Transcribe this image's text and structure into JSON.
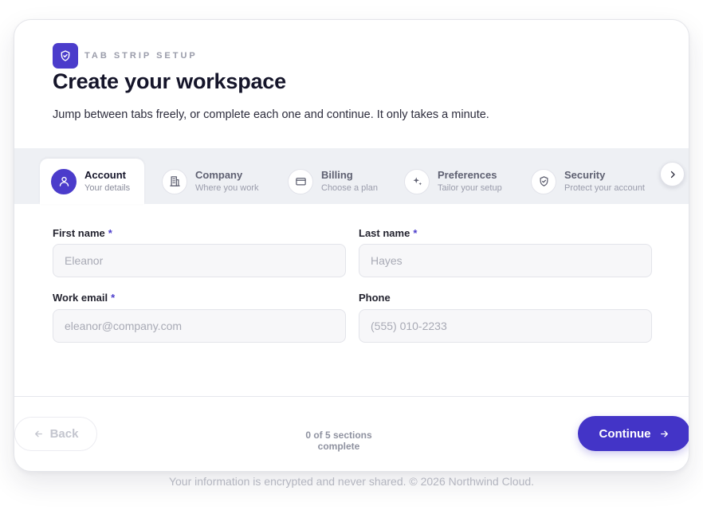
{
  "header": {
    "eyebrow": "TAB STRIP SETUP",
    "title": "Create your workspace",
    "subtitle": "Jump between tabs freely, or complete each one and continue. It only takes a minute."
  },
  "tabs": [
    {
      "label": "Account",
      "sub": "Your details",
      "icon": "user-icon",
      "active": true
    },
    {
      "label": "Company",
      "sub": "Where you work",
      "icon": "building-icon",
      "active": false
    },
    {
      "label": "Billing",
      "sub": "Choose a plan",
      "icon": "credit-card-icon",
      "active": false
    },
    {
      "label": "Preferences",
      "sub": "Tailor your setup",
      "icon": "sparkle-icon",
      "active": false
    },
    {
      "label": "Security",
      "sub": "Protect your account",
      "icon": "shield-icon",
      "active": false
    }
  ],
  "form": {
    "first_name": {
      "label": "First name",
      "required": "*",
      "placeholder": "Eleanor",
      "value": ""
    },
    "last_name": {
      "label": "Last name",
      "required": "*",
      "placeholder": "Hayes",
      "value": ""
    },
    "email": {
      "label": "Work email",
      "required": "*",
      "placeholder": "eleanor@company.com",
      "value": ""
    },
    "phone": {
      "label": "Phone",
      "placeholder": "(555) 010-2233",
      "value": ""
    }
  },
  "footer_bar": {
    "back_label": "Back",
    "progress": "0 of 5 sections complete",
    "continue_label": "Continue"
  },
  "footer_note": "Your information is encrypted and never shared. © 2026 Northwind Cloud.",
  "colors": {
    "accent": "#4b3ccb",
    "continue_bg": "#4334c7",
    "tabstrip_bg": "#eef0f4"
  }
}
